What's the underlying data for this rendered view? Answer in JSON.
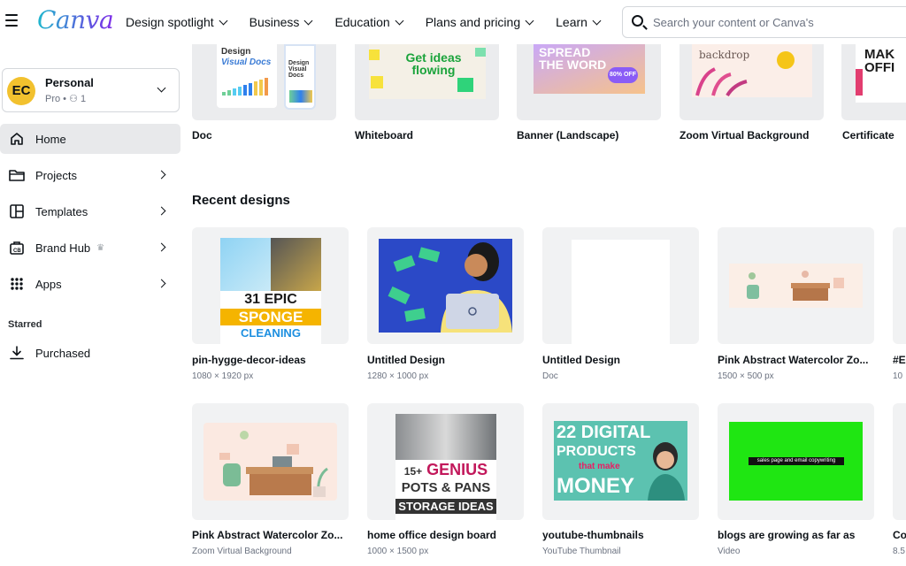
{
  "header": {
    "logo": "Canva",
    "nav": [
      {
        "label": "Design spotlight"
      },
      {
        "label": "Business"
      },
      {
        "label": "Education"
      },
      {
        "label": "Plans and pricing"
      },
      {
        "label": "Learn"
      }
    ],
    "search_placeholder": "Search your content or Canva's"
  },
  "account": {
    "initials": "EC",
    "name": "Personal",
    "plan": "Pro • ⚇ 1"
  },
  "sidebar": {
    "items": [
      {
        "label": "Home",
        "icon": "home-icon"
      },
      {
        "label": "Projects",
        "icon": "folder-icon"
      },
      {
        "label": "Templates",
        "icon": "templates-icon"
      },
      {
        "label": "Brand Hub",
        "icon": "brand-icon"
      },
      {
        "label": "Apps",
        "icon": "apps-grid-icon"
      }
    ],
    "starred_heading": "Starred",
    "purchased": "Purchased"
  },
  "design_types": [
    {
      "label": "Doc",
      "thumb": {
        "line1": "Design",
        "line2": "Visual Docs",
        "line3": "Design Visual Docs"
      }
    },
    {
      "label": "Whiteboard",
      "thumb": {
        "text": "Get ideas flowing"
      }
    },
    {
      "label": "Banner (Landscape)",
      "thumb": {
        "text": "SPREAD THE WORD",
        "badge": "80% OFF"
      }
    },
    {
      "label": "Zoom Virtual Background",
      "thumb": {
        "text": "backdrop"
      }
    },
    {
      "label": "Certificate",
      "thumb": {
        "text": "MAK OFFI"
      }
    }
  ],
  "recent": {
    "title": "Recent designs",
    "items": [
      {
        "title": "pin-hygge-decor-ideas",
        "meta": "1080 × 1920 px",
        "thumb": {
          "line1": "31 EPIC",
          "line2": "SPONGE",
          "line3": "CLEANING"
        }
      },
      {
        "title": "Untitled Design",
        "meta": "1280 × 1000 px"
      },
      {
        "title": "Untitled Design",
        "meta": "Doc"
      },
      {
        "title": "Pink Abstract Watercolor Zo...",
        "meta": "1500 × 500 px"
      },
      {
        "title": "#E",
        "meta": "10"
      },
      {
        "title": "Pink Abstract Watercolor Zo...",
        "meta": "Zoom Virtual Background"
      },
      {
        "title": "home office design board",
        "meta": "1000 × 1500 px",
        "thumb": {
          "line1": "15+",
          "line2": "GENIUS",
          "line3": "POTS & PANS",
          "line4": "STORAGE IDEAS"
        }
      },
      {
        "title": "youtube-thumbnails",
        "meta": "YouTube Thumbnail",
        "thumb": {
          "line1": "22 DIGITAL",
          "line2": "PRODUCTS",
          "line3": "that make",
          "line4": "MONEY"
        }
      },
      {
        "title": "blogs are growing as far as",
        "meta": "Video",
        "thumb": {
          "text": "sales page and email copywriting"
        }
      },
      {
        "title": "Co",
        "meta": "8.5"
      }
    ]
  }
}
